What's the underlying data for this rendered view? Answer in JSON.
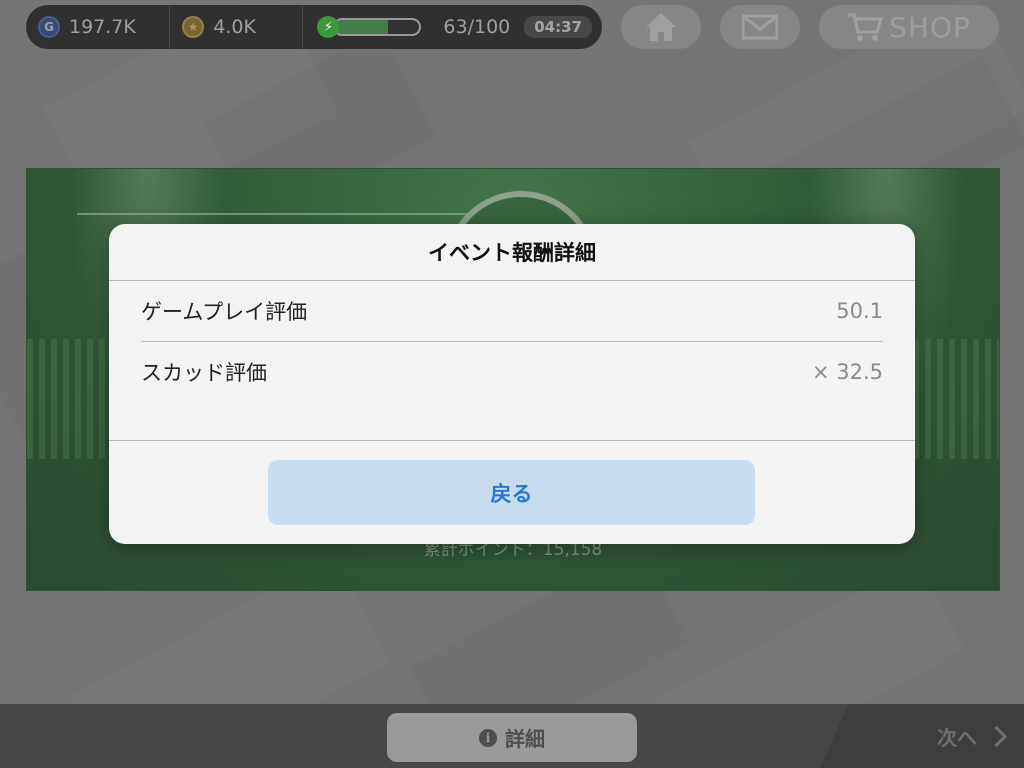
{
  "topbar": {
    "gp": "197.7K",
    "gp_icon": "G",
    "coins": "4.0K",
    "coin_icon": "★",
    "energy": {
      "value": 63,
      "max": 100,
      "label": "63/100",
      "fill_fraction": 0.63
    },
    "timer": "04:37"
  },
  "nav": {
    "shop_label": "SHOP"
  },
  "banner": {
    "total_points": "累計ポイント：15,158"
  },
  "dialog": {
    "title": "イベント報酬詳細",
    "rows": [
      {
        "label": "ゲームプレイ評価",
        "value": "50.1"
      },
      {
        "label": "スカッド評価",
        "value": "× 32.5"
      }
    ],
    "back_label": "戻る"
  },
  "bottom": {
    "detail_label": "詳細",
    "info_glyph": "i",
    "next_label": "次へ"
  },
  "colors": {
    "accent_blue": "#2a76d2",
    "button_bg": "#c8dcf0",
    "energy_green": "#2e9a38"
  }
}
